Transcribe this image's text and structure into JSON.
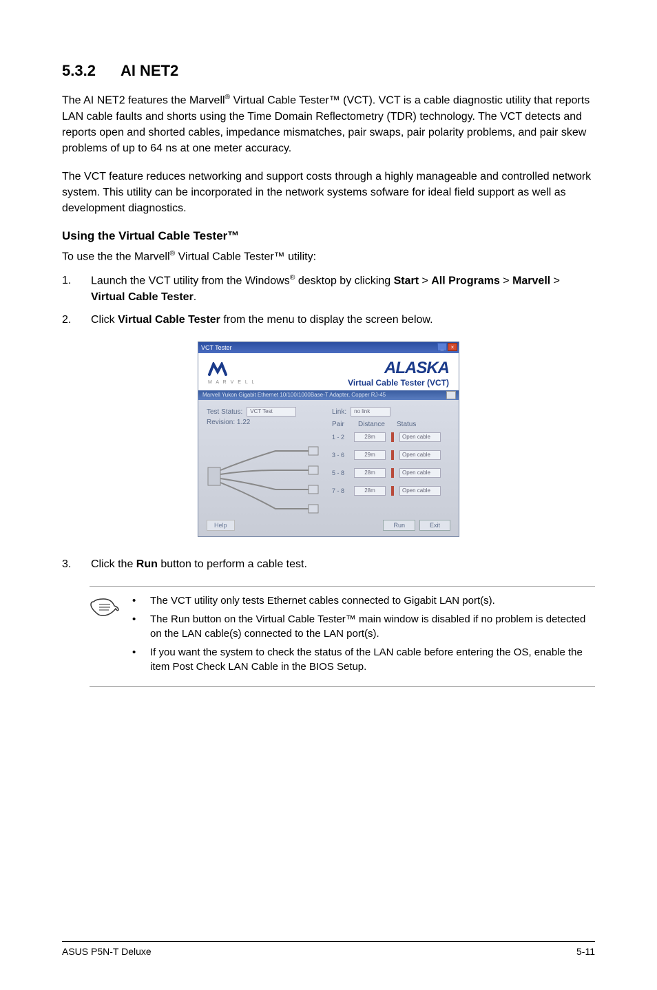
{
  "heading": {
    "number": "5.3.2",
    "title": "AI NET2"
  },
  "para1_pre": "The AI NET2 features the Marvell",
  "para1_post": " Virtual Cable Tester™ (VCT). VCT is a cable diagnostic utility that reports LAN cable faults and shorts using the Time Domain Reflectometry (TDR) technology. The VCT detects and reports open and shorted cables, impedance mismatches, pair swaps, pair polarity problems, and pair skew problems of up to 64 ns at one meter accuracy.",
  "para2": "The VCT feature reduces networking and support costs through a highly manageable and controlled network system. This utility can be incorporated in the network systems sofware for ideal field support as well as development diagnostics.",
  "subheading": "Using the Virtual Cable Tester™",
  "para3_pre": "To use the the Marvell",
  "para3_post": " Virtual Cable Tester™  utility:",
  "list": {
    "n1": "1.",
    "item1_pre": "Launch the VCT utility from the Windows",
    "item1_post": " desktop by clicking ",
    "item1_b1": "Start",
    "item1_gt1": " > ",
    "item1_b2": "All Programs",
    "item1_gt2": " > ",
    "item1_b3": "Marvell",
    "item1_gt3": " > ",
    "item1_b4": "Virtual Cable Tester",
    "item1_end": ".",
    "n2": "2.",
    "item2_pre": "Click ",
    "item2_b1": "Virtual Cable Tester",
    "item2_post": " from the menu to display the screen below.",
    "n3": "3.",
    "item3_pre": "Click the ",
    "item3_b1": "Run",
    "item3_post": " button to perform a cable test."
  },
  "screenshot": {
    "titlebar": "VCT Tester",
    "marvell_sub": "M A R V E L L",
    "alaska": "ALASKA",
    "vct_label": "Virtual Cable Tester (VCT)",
    "band_text": "Marvell Yukon Gigabit Ethernet 10/100/1000Base-T Adapter, Copper RJ-45",
    "test_status_label": "Test Status:",
    "test_status_value": "VCT Test",
    "version_label": "Revision: 1.22",
    "link_label": "Link:",
    "link_value": "no link",
    "hdr_pair": "Pair",
    "hdr_distance": "Distance",
    "hdr_status": "Status",
    "rows": [
      {
        "pair": "1 - 2",
        "distance": "28m",
        "status": "Open cable"
      },
      {
        "pair": "3 - 6",
        "distance": "29m",
        "status": "Open cable"
      },
      {
        "pair": "5 - 8",
        "distance": "28m",
        "status": "Open cable"
      },
      {
        "pair": "7 - 8",
        "distance": "28m",
        "status": "Open cable"
      }
    ],
    "footer_left": "Help",
    "btn_run": "Run",
    "btn_exit": "Exit"
  },
  "notes": {
    "b1": "The VCT utility only tests Ethernet cables connected to Gigabit LAN port(s).",
    "b2": "The Run button on the Virtual Cable Tester™ main window is disabled if no problem is detected on the LAN cable(s) connected to the LAN port(s).",
    "b3": "If you want the system to check the status of the LAN cable before entering the OS, enable the item Post Check LAN Cable in the BIOS Setup."
  },
  "footer": {
    "left": "ASUS P5N-T Deluxe",
    "right": "5-11"
  }
}
